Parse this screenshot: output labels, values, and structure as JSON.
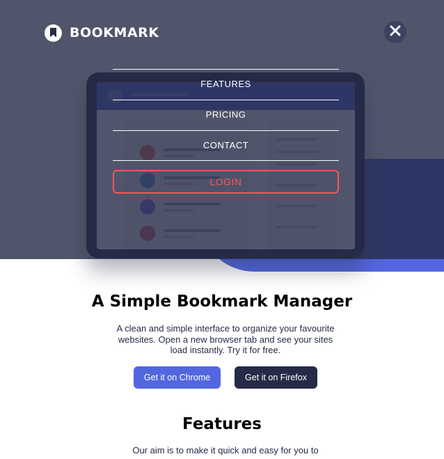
{
  "brand": {
    "name": "BOOKMARK"
  },
  "menu": {
    "items": [
      {
        "label": "FEATURES"
      },
      {
        "label": "PRICING"
      },
      {
        "label": "CONTACT"
      }
    ],
    "login_label": "LOGIN"
  },
  "hero": {
    "title": "A Simple Bookmark Manager",
    "description": "A clean and simple interface to organize your favourite websites. Open a new browser tab and see your sites load instantly. Try it for free.",
    "chrome_button": "Get it on Chrome",
    "firefox_button": "Get it on Firefox"
  },
  "features": {
    "title": "Features",
    "description": "Our aim is to make it quick and easy for you to"
  },
  "colors": {
    "primary_blue": "#5267df",
    "soft_red": "#fa5757",
    "very_dark_blue": "#252b46",
    "overlay": "rgba(37,43,70,0.80)"
  },
  "icons": {
    "logo": "bookmark-icon",
    "close": "close-icon"
  }
}
